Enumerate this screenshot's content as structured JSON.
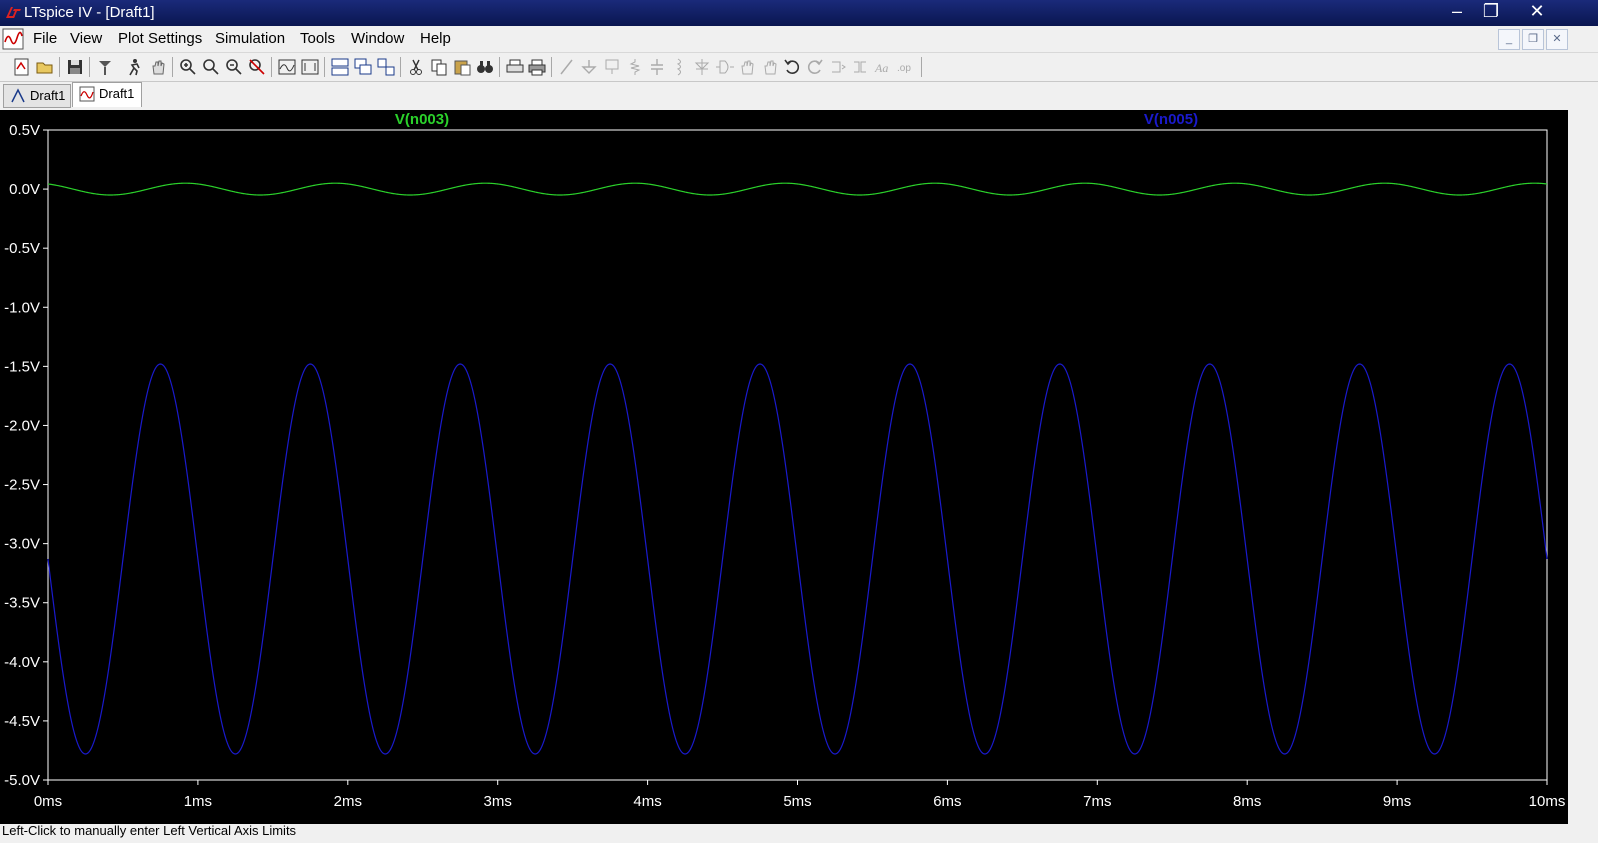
{
  "window": {
    "title": "LTspice IV - [Draft1]"
  },
  "menu": [
    "File",
    "View",
    "Plot Settings",
    "Simulation",
    "Tools",
    "Window",
    "Help"
  ],
  "tabs": [
    {
      "label": "Draft1",
      "kind": "schematic",
      "active": false
    },
    {
      "label": "Draft1",
      "kind": "waveform",
      "active": true
    }
  ],
  "status": "Left-Click to manually enter Left Vertical Axis Limits",
  "toolbar_icons": [
    "new-schematic-icon",
    "open-icon",
    "save-icon",
    "control-panel-icon",
    "run-icon",
    "pan-icon",
    "zoom-in-icon",
    "zoom-area-icon",
    "zoom-out-icon",
    "zoom-cancel-icon",
    "autorange-icon",
    "fit-icon",
    "tile-horizontal-icon",
    "cascade-icon",
    "tile-icon",
    "cut-icon",
    "copy-icon",
    "paste-icon",
    "find-icon",
    "print-preview-icon",
    "print-icon",
    "wire-icon",
    "ground-icon",
    "label-net-icon",
    "resistor-icon",
    "capacitor-icon",
    "inductor-icon",
    "diode-icon",
    "component-icon",
    "move-icon",
    "drag-icon",
    "undo-icon",
    "redo-icon",
    "rotate-icon",
    "mirror-icon",
    "text-icon",
    "spice-directive-icon"
  ],
  "colors": {
    "trace1": "#2bd12b",
    "trace2": "#1a1acc",
    "plot_bg": "#000000",
    "axis": "#ffffff"
  },
  "chart_data": {
    "type": "line",
    "x_unit": "ms",
    "xlim": [
      0,
      10
    ],
    "ylim": [
      -5.0,
      0.5
    ],
    "x_ticks": [
      "0ms",
      "1ms",
      "2ms",
      "3ms",
      "4ms",
      "5ms",
      "6ms",
      "7ms",
      "8ms",
      "9ms",
      "10ms"
    ],
    "y_ticks": [
      "0.5V",
      "0.0V",
      "-0.5V",
      "-1.0V",
      "-1.5V",
      "-2.0V",
      "-2.5V",
      "-3.0V",
      "-3.5V",
      "-4.0V",
      "-4.5V",
      "-5.0V"
    ],
    "grid": false,
    "series": [
      {
        "name": "V(n003)",
        "color": "#2bd12b",
        "waveform": "sine",
        "frequency_khz": 1.0,
        "offset_v": 0.0,
        "amplitude_v": 0.05,
        "phase_deg": 120
      },
      {
        "name": "V(n005)",
        "color": "#1a1acc",
        "waveform": "sine",
        "frequency_khz": 1.0,
        "offset_v": -3.13,
        "amplitude_v": 1.65,
        "phase_deg": 180
      }
    ]
  }
}
